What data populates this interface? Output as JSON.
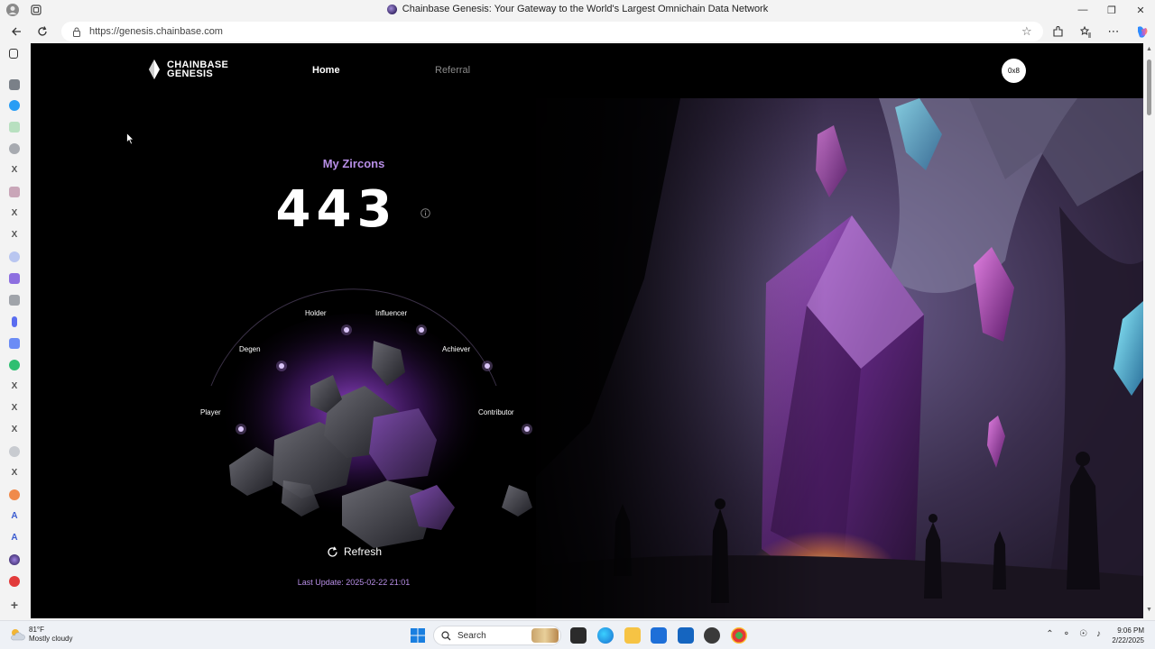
{
  "browser": {
    "tab_title": "Chainbase Genesis: Your Gateway to the World's Largest Omnichain Data Network",
    "url": "https://genesis.chainbase.com"
  },
  "site": {
    "logo_line1": "CHAINBASE",
    "logo_line2": "GENESIS",
    "nav": {
      "home": "Home",
      "referral": "Referral"
    },
    "wallet_label": "0x8"
  },
  "zircons": {
    "title": "My Zircons",
    "count": "443",
    "refresh_label": "Refresh",
    "last_update": "Last Update: 2025-02-22 21:01"
  },
  "orbit": {
    "labels": [
      "Player",
      "Degen",
      "Holder",
      "Influencer",
      "Achiever",
      "Contributor"
    ]
  },
  "taskbar": {
    "weather_temp": "81°F",
    "weather_desc": "Mostly cloudy",
    "search_placeholder": "Search",
    "time": "9:06 PM",
    "date": "2/22/2025"
  },
  "colors": {
    "accent_purple": "#b78ee6",
    "page_bg": "#000000"
  }
}
